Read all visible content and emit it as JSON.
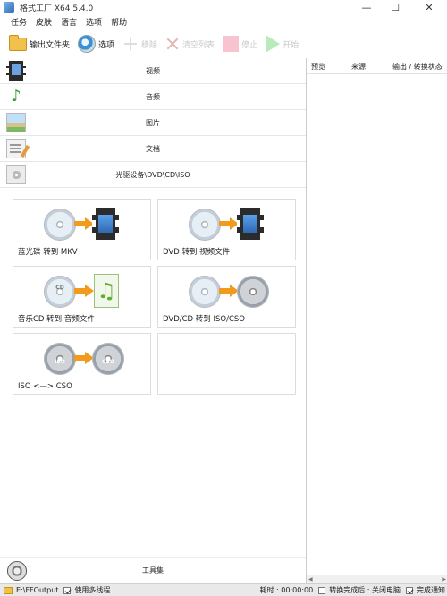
{
  "window": {
    "title": "格式工厂 X64 5.4.0",
    "minimize": "—",
    "maximize": "☐",
    "close": "✕"
  },
  "menu": [
    "任务",
    "皮肤",
    "语言",
    "选项",
    "帮助"
  ],
  "toolbar": {
    "output_folder": "输出文件夹",
    "options": "选项",
    "remove": "移除",
    "clear_list": "清空列表",
    "stop": "停止",
    "start": "开始"
  },
  "categories": [
    {
      "label": "视频",
      "icon": "video-film-icon"
    },
    {
      "label": "音频",
      "icon": "audio-note-icon"
    },
    {
      "label": "图片",
      "icon": "picture-icon"
    },
    {
      "label": "文档",
      "icon": "document-icon"
    },
    {
      "label": "光驱设备\\DVD\\CD\\ISO",
      "icon": "disc-device-icon"
    }
  ],
  "tiles": [
    {
      "label": "蓝光碟 转到 MKV"
    },
    {
      "label": "DVD 转到 视频文件"
    },
    {
      "label": "音乐CD 转到 音频文件",
      "disc_text": "CD"
    },
    {
      "label": "DVD/CD 转到 ISO/CSO"
    },
    {
      "label": "ISO <—> CSO",
      "left_disc": "ISO",
      "right_disc": "CSO"
    },
    {
      "label": ""
    }
  ],
  "toolbox": {
    "label": "工具集"
  },
  "task_list": {
    "columns": [
      "预览",
      "来源",
      "输出 / 转换状态"
    ]
  },
  "statusbar": {
    "output_path": "E:\\FFOutput",
    "multithread": "使用多线程",
    "elapsed": "耗时 : 00:00:00",
    "after_convert": "转换完成后 : 关闭电脑",
    "notify": "完成通知"
  }
}
